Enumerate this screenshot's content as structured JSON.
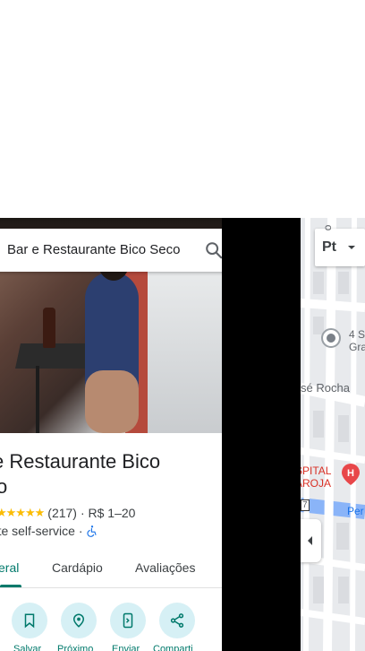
{
  "search": {
    "query": "Bar e Restaurante Bico Seco"
  },
  "place": {
    "title_line1": "e Restaurante Bico",
    "title_line2": "o",
    "stars": "★★★★★",
    "rating_count": "(217)",
    "price": "· R$ 1–20",
    "category": "ante self-service ·"
  },
  "tabs": [
    {
      "label": "eral"
    },
    {
      "label": "Cardápio"
    },
    {
      "label": "Avaliações"
    }
  ],
  "actions": [
    {
      "label": "Salvar",
      "icon": "bookmark-icon"
    },
    {
      "label": "Próximo",
      "icon": "nearby-icon"
    },
    {
      "label": "Enviar",
      "icon": "send-to-phone-icon"
    },
    {
      "label": "Comparti",
      "icon": "share-icon"
    }
  ],
  "map": {
    "layer_button": "Pt",
    "labels": [
      "4 S",
      "Gra",
      "sé Rocha",
      "SPITAL",
      "AROJA",
      "Per",
      "7",
      "o"
    ],
    "colors": {
      "accent": "#00796b",
      "hospital": "#d93025",
      "road": "#8ab4f8"
    }
  }
}
